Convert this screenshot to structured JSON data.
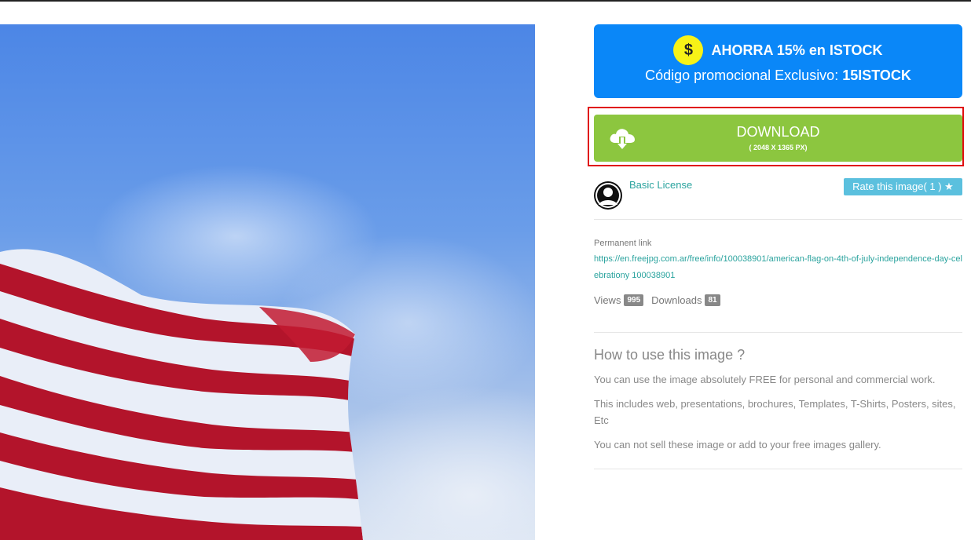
{
  "promo": {
    "coin_symbol": "$",
    "title": "AHORRA 15% en ISTOCK",
    "subtitle_prefix": "Código promocional Exclusivo: ",
    "code": "15ISTOCK",
    "color": "#0a87f8"
  },
  "download": {
    "label": "DOWNLOAD",
    "size": "( 2048 X 1365 PX)",
    "icon": "cloud-download-icon",
    "color": "#8cc63f"
  },
  "license": {
    "label": "Basic License",
    "rate_label": "Rate this image( 1 ) ★"
  },
  "permalink": {
    "label": "Permanent link",
    "url": "https://en.freejpg.com.ar/free/info/100038901/american-flag-on-4th-of-july-independence-day-celebrationy 100038901"
  },
  "stats": {
    "views_label": "Views",
    "views": "995",
    "downloads_label": "Downloads",
    "downloads": "81"
  },
  "howto": {
    "title": "How to use this image ?",
    "p1": "You can use the image absolutely FREE for personal and commercial work.",
    "p2": "This includes web, presentations, brochures, Templates, T-Shirts, Posters, sites, Etc",
    "p3": "You can not sell these image or add to your free images gallery."
  }
}
